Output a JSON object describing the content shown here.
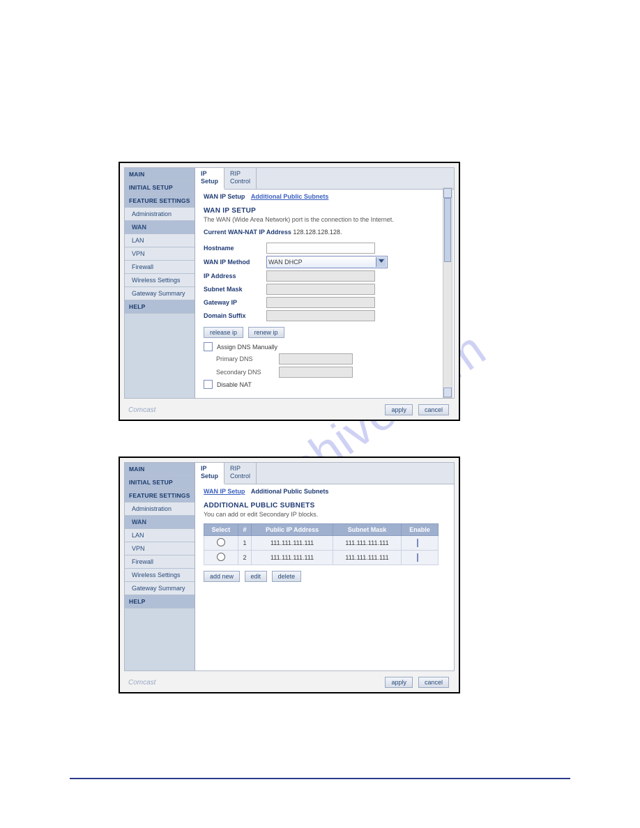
{
  "watermark": "manualshive.com",
  "sidebar": {
    "main": "MAIN",
    "initial": "INITIAL SETUP",
    "feature": "FEATURE SETTINGS",
    "subs": {
      "admin": "Administration",
      "wan": "WAN",
      "lan": "LAN",
      "vpn": "VPN",
      "firewall": "Firewall",
      "wireless": "Wireless Settings",
      "summary": "Gateway Summary"
    },
    "help": "HELP"
  },
  "tabs": {
    "ip_setup_line1": "IP",
    "ip_setup_line2": "Setup",
    "rip_line1": "RIP",
    "rip_line2": "Control"
  },
  "panel1": {
    "bc1": "WAN IP Setup",
    "bc2": "Additional Public Subnets",
    "title": "WAN IP SETUP",
    "desc": "The WAN (Wide Area Network) port is the connection to the Internet.",
    "curlabel": "Current WAN-NAT IP Address",
    "curval": "128.128.128.128.",
    "labels": {
      "hostname": "Hostname",
      "method": "WAN IP Method",
      "ip": "IP Address",
      "mask": "Subnet Mask",
      "gw": "Gateway IP",
      "suffix": "Domain Suffix"
    },
    "method_value": "WAN DHCP",
    "btn_release": "release ip",
    "btn_renew": "renew ip",
    "chk_assign": "Assign DNS Manually",
    "lbl_primary": "Primary DNS",
    "lbl_secondary": "Secondary DNS",
    "chk_nat": "Disable NAT"
  },
  "panel2": {
    "bc1": "WAN IP Setup",
    "bc2": "Additional Public Subnets",
    "title": "ADDITIONAL PUBLIC SUBNETS",
    "desc": "You can add or edit Secondary IP blocks.",
    "headers": {
      "select": "Select",
      "num": "#",
      "ip": "Public IP Address",
      "mask": "Subnet Mask",
      "enable": "Enable"
    },
    "rows": [
      {
        "num": "1",
        "ip": "111.111.111.111",
        "mask": "111.111.111.111"
      },
      {
        "num": "2",
        "ip": "111.111.111.111",
        "mask": "111.111.111.111"
      }
    ],
    "btn_add": "add new",
    "btn_edit": "edit",
    "btn_delete": "delete"
  },
  "footer": {
    "brand": "Comcast",
    "apply": "apply",
    "cancel": "cancel"
  }
}
